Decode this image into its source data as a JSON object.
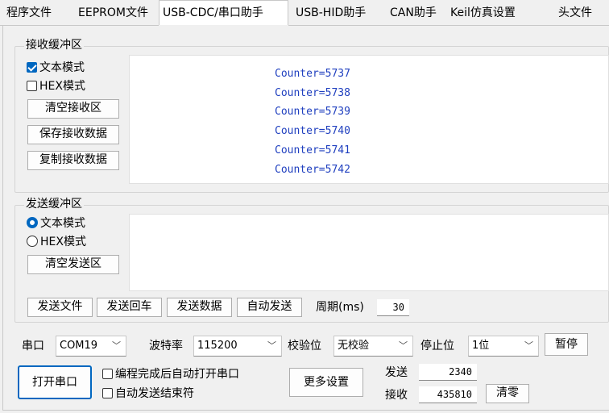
{
  "tabs": [
    {
      "label": "程序文件"
    },
    {
      "label": "EEPROM文件"
    },
    {
      "label": "USB-CDC/串口助手"
    },
    {
      "label": "USB-HID助手"
    },
    {
      "label": "CAN助手"
    },
    {
      "label": "Keil仿真设置"
    },
    {
      "label": "头文件"
    }
  ],
  "receive": {
    "legend": "接收缓冲区",
    "text_mode": "文本模式",
    "hex_mode": "HEX模式",
    "clear": "清空接收区",
    "save": "保存接收数据",
    "copy": "复制接收数据",
    "lines": [
      "Counter=5737",
      "Counter=5738",
      "Counter=5739",
      "Counter=5740",
      "Counter=5741",
      "Counter=5742"
    ]
  },
  "send": {
    "legend": "发送缓冲区",
    "text_mode": "文本模式",
    "hex_mode": "HEX模式",
    "clear": "清空发送区",
    "send_file": "发送文件",
    "send_enter": "发送回车",
    "send_data": "发送数据",
    "auto_send": "自动发送",
    "period_label": "周期(ms)",
    "period_value": "30"
  },
  "settings": {
    "port_label": "串口",
    "port_value": "COM19",
    "baud_label": "波特率",
    "baud_value": "115200",
    "parity_label": "校验位",
    "parity_value": "无校验",
    "stop_label": "停止位",
    "stop_value": "1位",
    "pause": "暂停",
    "open_port": "打开串口",
    "auto_open": "编程完成后自动打开串口",
    "auto_end": "自动发送结束符",
    "more": "更多设置",
    "sent_label": "发送",
    "sent_value": "2340",
    "recv_label": "接收",
    "recv_value": "435810",
    "reset": "清零"
  },
  "colors": {
    "accent": "#0067c0",
    "rx_text": "#1f3fbf"
  }
}
